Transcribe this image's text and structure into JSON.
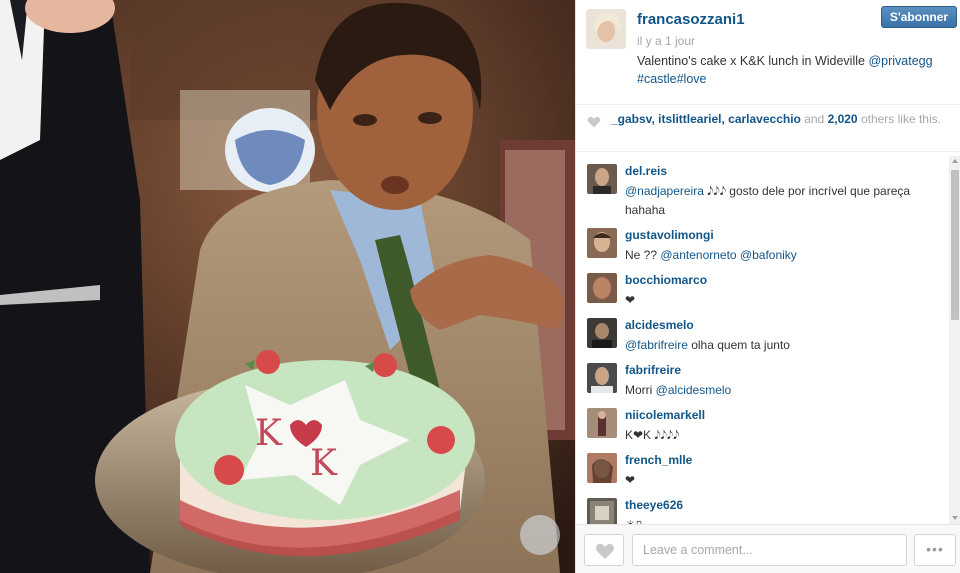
{
  "post": {
    "owner": "francasozzani1",
    "follow_label": "S'abonner",
    "time_ago": "il y a 1 jour",
    "caption_text": "Valentino's cake x K&K lunch in Wideville ",
    "caption_mention": "@privategg",
    "caption_tags": "#castle#love",
    "cake_text": "K K"
  },
  "likes": {
    "users": "_gabsv, itslittleariel, carlavecchio",
    "and": " and ",
    "count": "2,020",
    "suffix": " others like this."
  },
  "comments": [
    {
      "user": "del.reis",
      "mention": "@nadjapereira",
      "text": " 𝅘𝅥𝅮𝅘𝅥𝅮𝅘𝅥𝅮 gosto dele por incrível que pareça hahaha",
      "avatar_color": "#6b5a4e"
    },
    {
      "user": "gustavolimongi",
      "mention": "",
      "text": "Ne ?? ",
      "text2_mention": "@antenorneto @bafoniky",
      "avatar_color": "#8a6a55"
    },
    {
      "user": "bocchiomarco",
      "mention": "",
      "text": "❤",
      "avatar_color": "#7a5a48"
    },
    {
      "user": "alcidesmelo",
      "mention": "@fabrifreire",
      "text": " olha quem ta junto",
      "avatar_color": "#3d3a36"
    },
    {
      "user": "fabrifreire",
      "mention": "",
      "text": "Morri ",
      "text2_mention": "@alcidesmelo",
      "avatar_color": "#4b4b4b"
    },
    {
      "user": "niicolemarkell",
      "mention": "",
      "text": "K❤K 𝅘𝅥𝅮𝅘𝅥𝅮𝅘𝅥𝅮𝅘𝅥𝅮",
      "avatar_color": "#a58d7a"
    },
    {
      "user": "french_mlle",
      "mention": "",
      "text": "❤",
      "avatar_color": "#b07b62"
    },
    {
      "user": "theeye626",
      "mention": "",
      "text": "☀▯",
      "avatar_color": "#5f5a52"
    }
  ],
  "footer": {
    "comment_placeholder": "Leave a comment...",
    "more_label": "•••"
  },
  "colors": {
    "link": "#125688",
    "muted": "#a5a7aa",
    "follow_button": "#3a73a8"
  },
  "icons": {
    "like": "heart-icon",
    "more": "ellipsis-icon"
  }
}
